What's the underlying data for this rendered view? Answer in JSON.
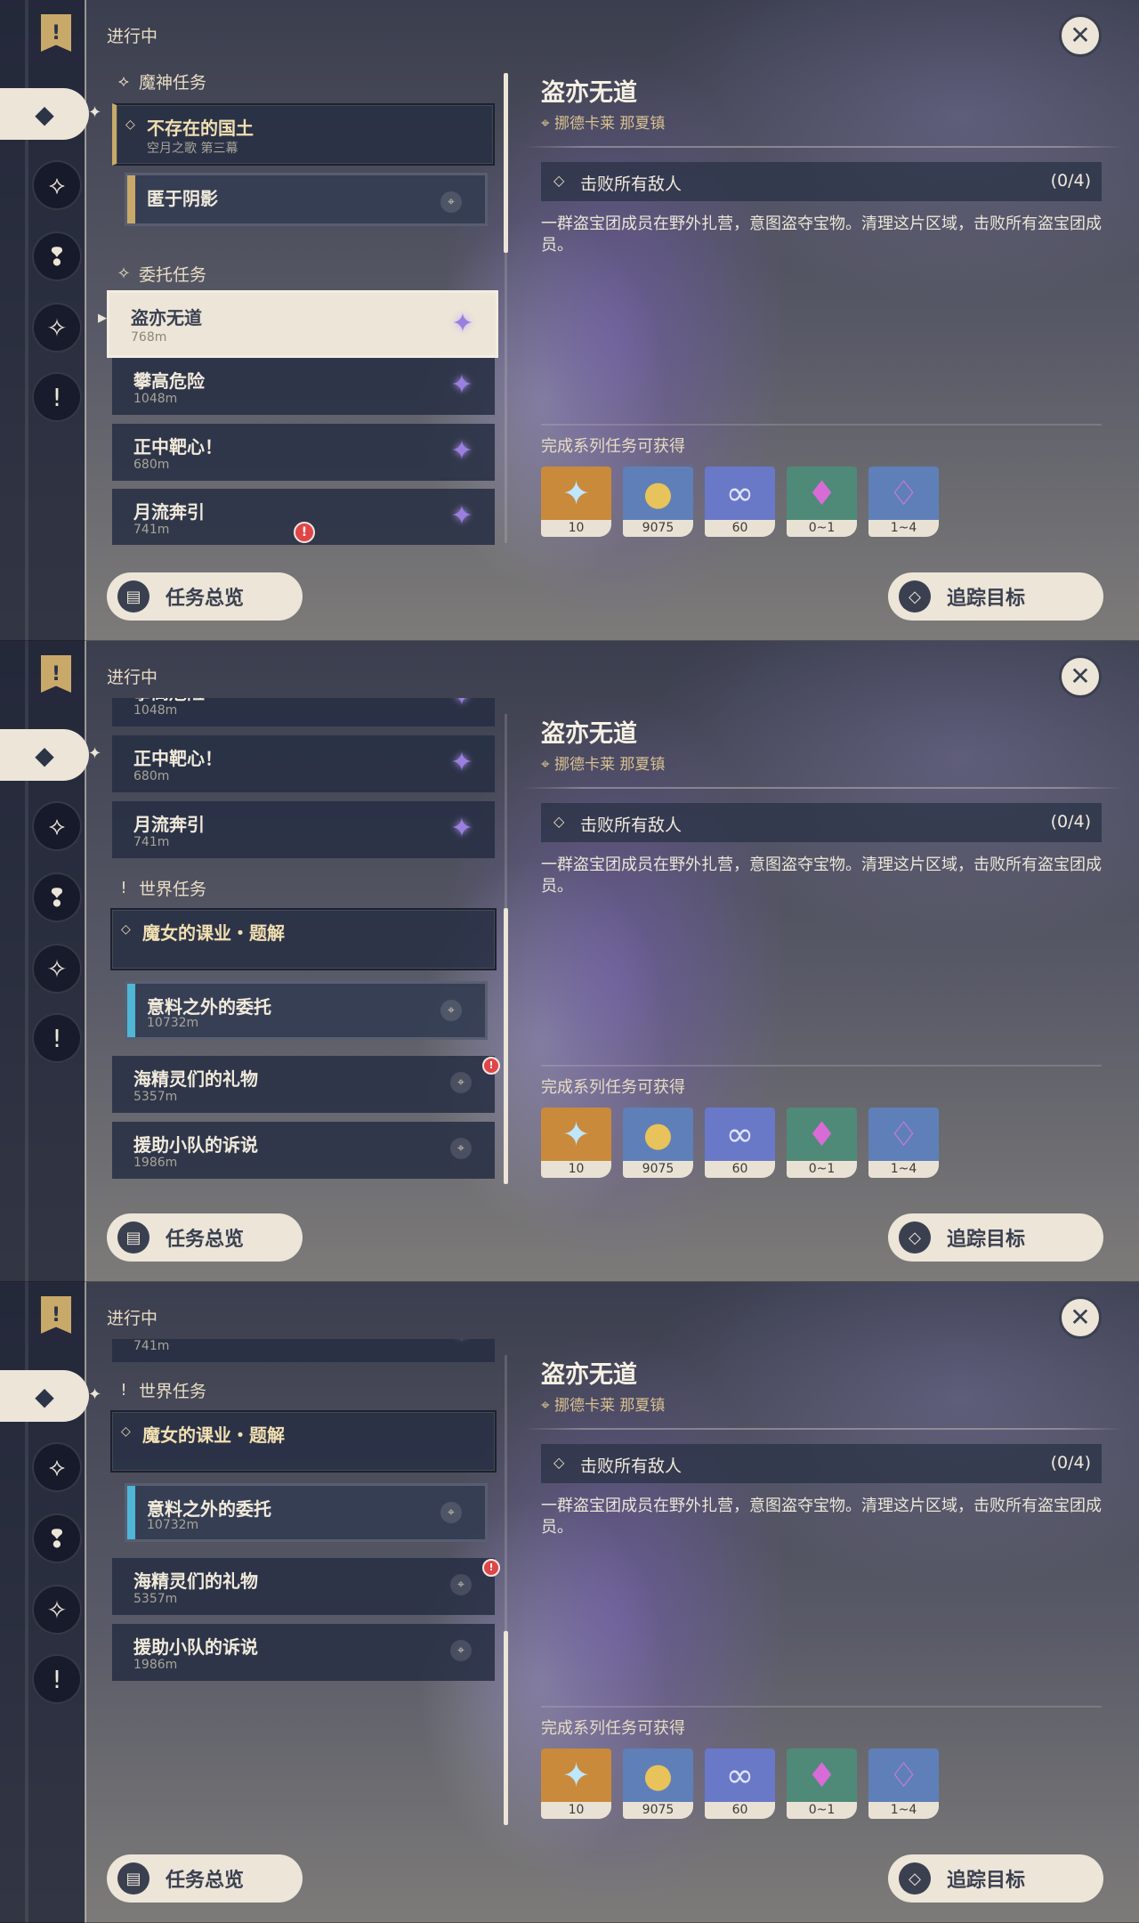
{
  "header": {
    "in_progress": "进行中"
  },
  "sections": {
    "archon": "魔神任务",
    "commission": "委托任务",
    "world": "世界任务"
  },
  "quests": {
    "archon_main": {
      "title": "不存在的国土",
      "sub": "空月之歌 第三幕"
    },
    "archon_step": {
      "title": "匿于阴影"
    },
    "q_daoyi": {
      "title": "盗亦无道",
      "dist": "768m"
    },
    "q_pangao": {
      "title": "攀高危险",
      "dist": "1048m"
    },
    "q_zhengzhong": {
      "title": "正中靶心！",
      "dist": "680m"
    },
    "q_yueliu": {
      "title": "月流奔引",
      "dist": "741m"
    },
    "world_main": {
      "title": "魔女的课业・题解"
    },
    "world_step": {
      "title": "意料之外的委托",
      "dist": "10732m"
    },
    "q_haijing": {
      "title": "海精灵们的礼物",
      "dist": "5357m"
    },
    "q_yuanzhu": {
      "title": "援助小队的诉说",
      "dist": "1986m"
    }
  },
  "detail": {
    "title": "盗亦无道",
    "location": "挪德卡莱 那夏镇",
    "objective": "击败所有敌人",
    "progress": "(0/4)",
    "description": "一群盗宝团成员在野外扎营，意图盗夺宝物。清理这片区域，击败所有盗宝团成员。",
    "rewards_label": "完成系列任务可获得",
    "rewards": [
      {
        "icon": "primogem-icon",
        "count": "10",
        "color": "#c98a3c"
      },
      {
        "icon": "mora-icon",
        "count": "9075",
        "color": "#5f7fb8"
      },
      {
        "icon": "companionship-exp-icon",
        "count": "60",
        "color": "#6a78c8"
      },
      {
        "icon": "crystal-chunk-icon",
        "count": "0~1",
        "color": "#4f8a78"
      },
      {
        "icon": "crystal-cluster-icon",
        "count": "1~4",
        "color": "#5f7fb8"
      }
    ]
  },
  "buttons": {
    "overview": "任务总览",
    "track": "追踪目标"
  },
  "icons": {
    "close": "close-icon",
    "notification": "!"
  }
}
